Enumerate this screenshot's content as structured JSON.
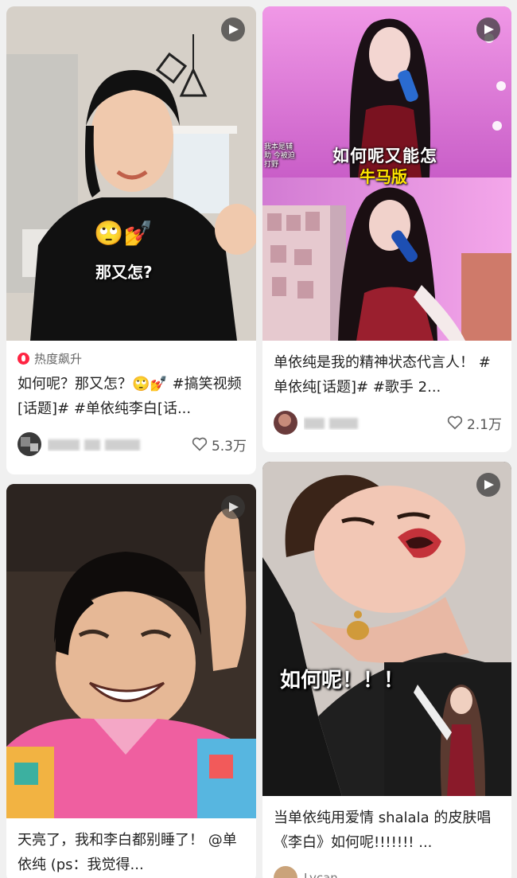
{
  "cards": [
    {
      "badge": "热度飙升",
      "title": "如何呢？那又怎？🙄💅 #搞笑视频[话题]# #单依纯李白[话...",
      "likes": "5.3万",
      "overlay": {
        "emoji": "🙄💅",
        "text": "那又怎?"
      }
    },
    {
      "title": "单依纯是我的精神状态代言人！ #单依纯[话题]# #歌手 2...",
      "likes": "2.1万",
      "overlay": {
        "line1": "如何呢又能怎",
        "line2": "牛马版",
        "small": "我本是辅助 今被迫打野"
      }
    },
    {
      "title": "天亮了，我和李白都别睡了！ @单依纯 (ps：我觉得..."
    },
    {
      "title": "当单依纯用爱情 shalala 的皮肤唱《李白》如何呢!!!!!!! ...",
      "author": "Lycan",
      "overlay": {
        "text": "如何呢！！！"
      }
    }
  ],
  "icons": {
    "play": "play-icon",
    "heart": "heart-icon",
    "hot": "flame-icon"
  },
  "colors": {
    "accent": "#ff2442",
    "background": "#f0f0f0"
  }
}
